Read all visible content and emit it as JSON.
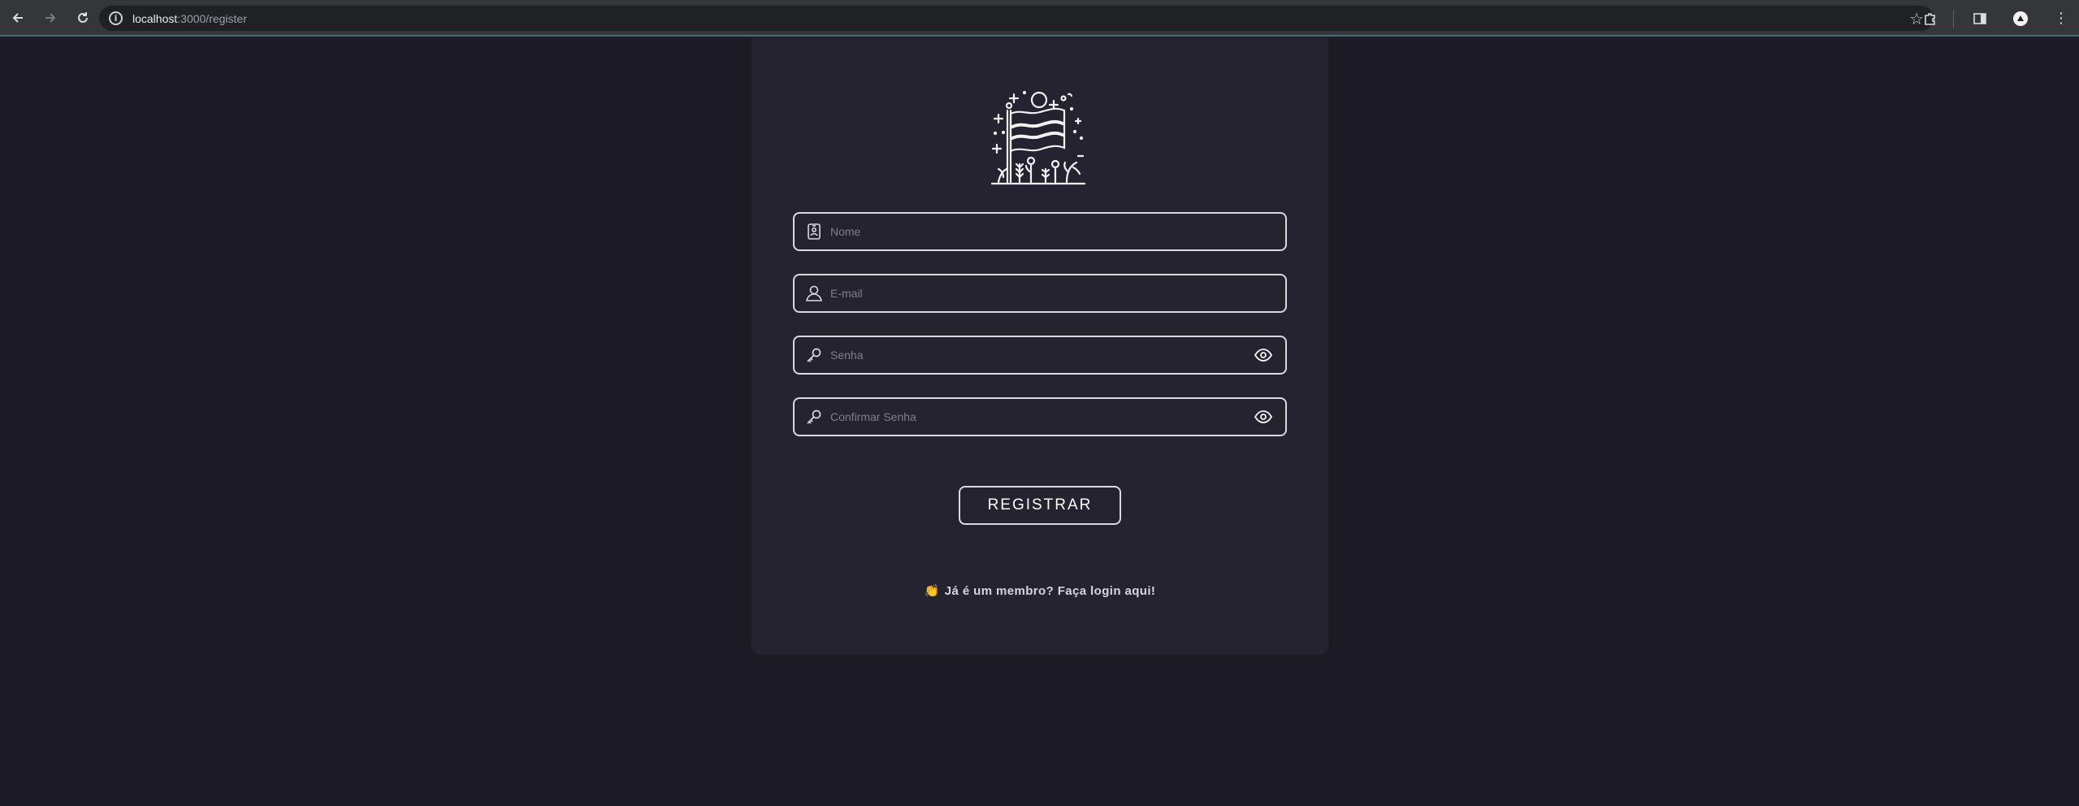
{
  "browser": {
    "url_host": "localhost",
    "url_path": ":3000/register",
    "back_icon": "arrow-left-icon",
    "forward_icon": "arrow-right-icon",
    "reload_icon": "reload-icon",
    "info_icon": "info-icon",
    "bookmark_icon": "star-icon",
    "extensions_icon": "puzzle-icon",
    "sidepanel_icon": "sidepanel-icon",
    "profile_icon": "profile-icon",
    "menu_icon": "kebab-menu-icon"
  },
  "form": {
    "logo_icon": "flag-celebration-icon",
    "fields": [
      {
        "placeholder": "Nome",
        "icon": "badge-icon"
      },
      {
        "placeholder": "E-mail",
        "icon": "user-icon"
      },
      {
        "placeholder": "Senha",
        "icon": "key-icon",
        "toggle_icon": "eye-icon"
      },
      {
        "placeholder": "Confirmar Senha",
        "icon": "key-icon",
        "toggle_icon": "eye-icon"
      }
    ],
    "submit_label": "REGISTRAR",
    "login_emoji": "👏",
    "login_text": "Já é um membro? Faça login aqui!"
  },
  "colors": {
    "page_bg": "#1c1b24",
    "card_bg": "#24232f",
    "border": "#d9d9e0",
    "placeholder": "#7f7e8a"
  }
}
